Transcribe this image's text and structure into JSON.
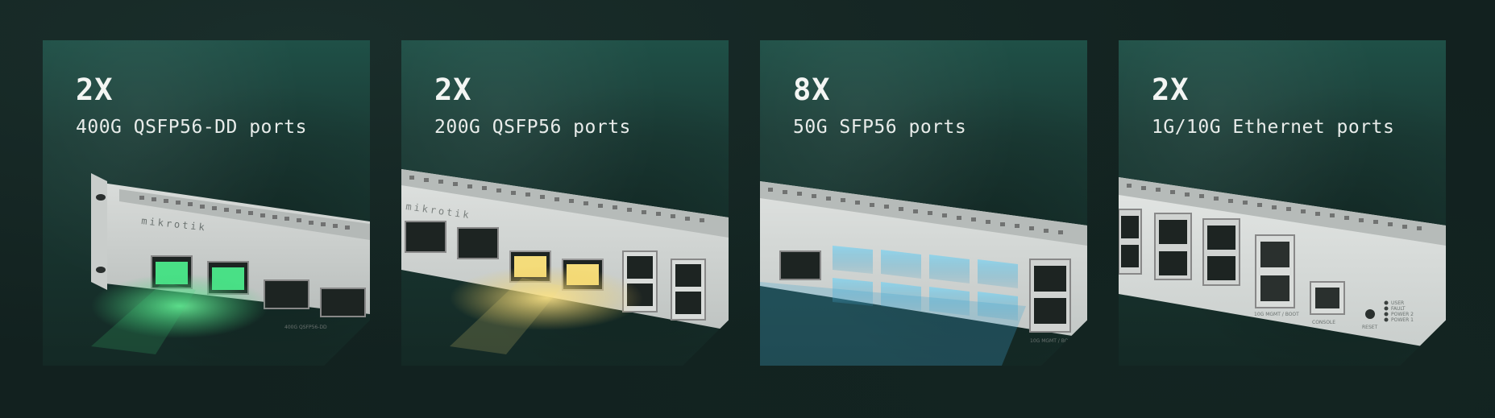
{
  "features": [
    {
      "count": "2X",
      "description": "400G QSFP56-DD ports",
      "glow": "#3fd07a",
      "device_brand": "mikrotik",
      "tiny_labels": [
        "400G QSFP56-DD"
      ]
    },
    {
      "count": "2X",
      "description": "200G QSFP56 ports",
      "glow": "#e9c85a",
      "device_brand": "mikrotik",
      "tiny_labels": []
    },
    {
      "count": "8X",
      "description": "50G SFP56 ports",
      "glow": "#59b8dc",
      "device_brand": "",
      "tiny_labels": [
        "10G MGMT / BOOT"
      ]
    },
    {
      "count": "2X",
      "description": "1G/10G Ethernet ports",
      "glow": "#ffffff",
      "device_brand": "",
      "tiny_labels": [
        "10G MGMT / BOOT",
        "CONSOLE",
        "RESET",
        "USER",
        "FAULT",
        "POWER 2",
        "POWER 1"
      ]
    }
  ]
}
